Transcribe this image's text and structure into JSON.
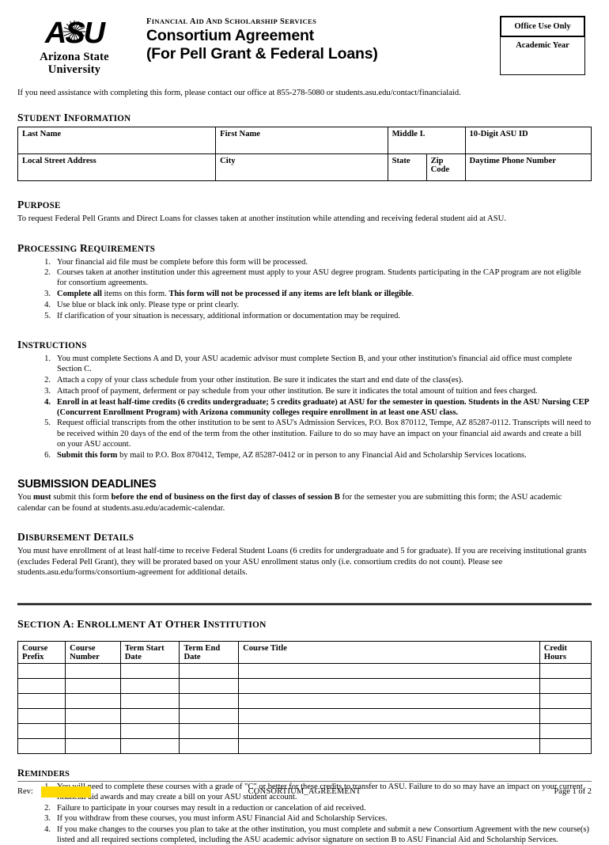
{
  "header": {
    "logo": {
      "mark": "ASU",
      "name_line1": "Arizona State",
      "name_line2": "University"
    },
    "department": "Financial Aid and Scholarship Services",
    "title_line1": "Consortium Agreement",
    "title_line2": "(For Pell Grant & Federal Loans)",
    "office_use_only": "Office Use Only",
    "academic_year": "Academic Year",
    "assistance": "If you need assistance with completing this form, please contact our office at 855-278-5080 or students.asu.edu/contact/financialaid."
  },
  "student_information": {
    "heading": "Student Information",
    "row1": [
      "Last Name",
      "First Name",
      "Middle I.",
      "10-Digit ASU ID"
    ],
    "row2": [
      "Local Street Address",
      "City",
      "State",
      "Zip Code",
      "Daytime Phone Number"
    ]
  },
  "purpose": {
    "heading": "Purpose",
    "text": "To request Federal Pell Grants and Direct Loans for classes taken at another institution while attending and receiving federal student aid at ASU."
  },
  "processing_requirements": {
    "heading": "Processing Requirements",
    "items": [
      "Your financial aid file must be complete before this form will be processed.",
      "Courses taken at another institution under this agreement must apply to your ASU degree program.  Students participating in the CAP program are not eligible for consortium agreements.",
      "Complete all items on this form. This form will not be processed if any items are left blank or illegible.",
      "Use blue or black ink only. Please type or print clearly.",
      "If clarification of your situation is necessary, additional information or documentation may be required."
    ]
  },
  "instructions": {
    "heading": "Instructions",
    "items": [
      "You must complete Sections A and D, your ASU academic advisor must complete Section B, and your other institution's financial aid office must complete Section C.",
      "Attach a copy of your class schedule from your other institution.  Be sure it indicates the start and end date of the class(es).",
      "Attach proof of payment, deferment or pay schedule from your other institution.  Be sure it indicates the total amount of tuition and fees charged.",
      "Enroll in at least half-time credits (6 credits undergraduate; 5 credits graduate) at ASU for the semester in question.  Students in the ASU Nursing CEP (Concurrent Enrollment Program) with Arizona community colleges require enrollment in at least one ASU class.",
      "Request official transcripts from the other institution to be sent to ASU's Admission Services, P.O. Box 870112, Tempe, AZ 85287-0112. Transcripts will need to be received within 20 days of the end of the term from the other institution. Failure to do so may have an impact on your financial aid awards and create a bill on your ASU account.",
      "Submit this form by mail to P.O. Box 870412, Tempe, AZ 85287-0412 or in person to any Financial Aid and Scholarship Services locations."
    ]
  },
  "submission_deadlines": {
    "heading": "SUBMISSION DEADLINES",
    "text_pre": "You ",
    "bold1": "must",
    "text_mid": " submit this form ",
    "bold2": "before the end of business on the first day of classes of session B",
    "text_post": " for the semester you are submitting this form; the ASU academic calendar can be found at students.asu.edu/academic-calendar."
  },
  "disbursement_details": {
    "heading": "Disbursement Details",
    "text": "You must have enrollment of at least half-time to receive Federal Student Loans (6 credits for undergraduate and 5 for graduate).  If you are receiving institutional grants (excludes Federal Pell Grant), they will be prorated based on your ASU enrollment status only (i.e. consortium credits do not count).  Please see students.asu.edu/forms/consortium-agreement for additional details."
  },
  "section_a": {
    "heading": "Section A: Enrollment at Other Institution",
    "columns": [
      "Course Prefix",
      "Course Number",
      "Term Start Date",
      "Term End Date",
      "Course Title",
      "Credit Hours"
    ],
    "row_count": 6,
    "rows": [
      [
        "",
        "",
        "",
        "",
        "",
        ""
      ],
      [
        "",
        "",
        "",
        "",
        "",
        ""
      ],
      [
        "",
        "",
        "",
        "",
        "",
        ""
      ],
      [
        "",
        "",
        "",
        "",
        "",
        ""
      ],
      [
        "",
        "",
        "",
        "",
        "",
        ""
      ],
      [
        "",
        "",
        "",
        "",
        "",
        ""
      ]
    ]
  },
  "reminders": {
    "heading": "Reminders",
    "items": [
      "You will need to complete these courses with a grade of \"C\" or better for these credits to transfer to ASU.  Failure to do so may have an impact on your current financial aid awards and may create a bill on your ASU student account.",
      "Failure to participate in your courses may result in a reduction or cancelation of aid received.",
      "If you withdraw from these courses, you must inform ASU Financial Aid and Scholarship Services.",
      "If you make changes to the courses you plan to take at the other institution, you must complete and submit a new Consortium Agreement with the new course(s) listed and all required sections completed, including the ASU academic advisor signature on section B to ASU Financial Aid and Scholarship Services."
    ]
  },
  "footer": {
    "rev_label": "Rev:",
    "rev_value": "",
    "form_code": "CONSORTIUM_AGREEMENT",
    "page": "Page 1 of 2",
    "highlight_color": "#FFD900"
  }
}
